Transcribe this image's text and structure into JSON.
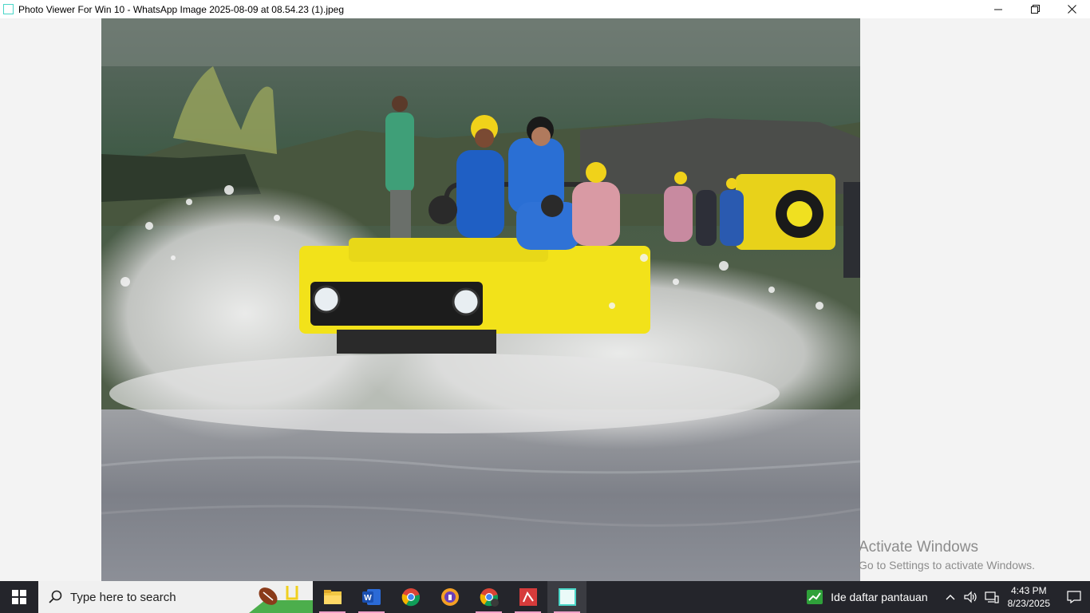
{
  "window": {
    "title": "Photo Viewer For Win 10 - WhatsApp Image 2025-08-09 at 08.54.23 (1).jpeg",
    "controls": [
      "minimize-icon",
      "restore-icon",
      "close-icon"
    ]
  },
  "watermark": {
    "line1": "Activate Windows",
    "line2": "Go to Settings to activate Windows."
  },
  "taskbar": {
    "search_placeholder": "Type here to search",
    "apps": [
      "file-explorer-icon",
      "word-icon",
      "chrome-icon",
      "vpn-shield-icon",
      "chrome-profile-icon",
      "pdf-reader-icon",
      "photo-viewer-icon"
    ],
    "news_text": "Ide daftar pantauan",
    "time": "4:43 PM",
    "date": "8/23/2025"
  },
  "colors": {
    "accent": "#4ad6c8",
    "taskbar": "#24252b",
    "jeep_yellow": "#f2e21a"
  }
}
